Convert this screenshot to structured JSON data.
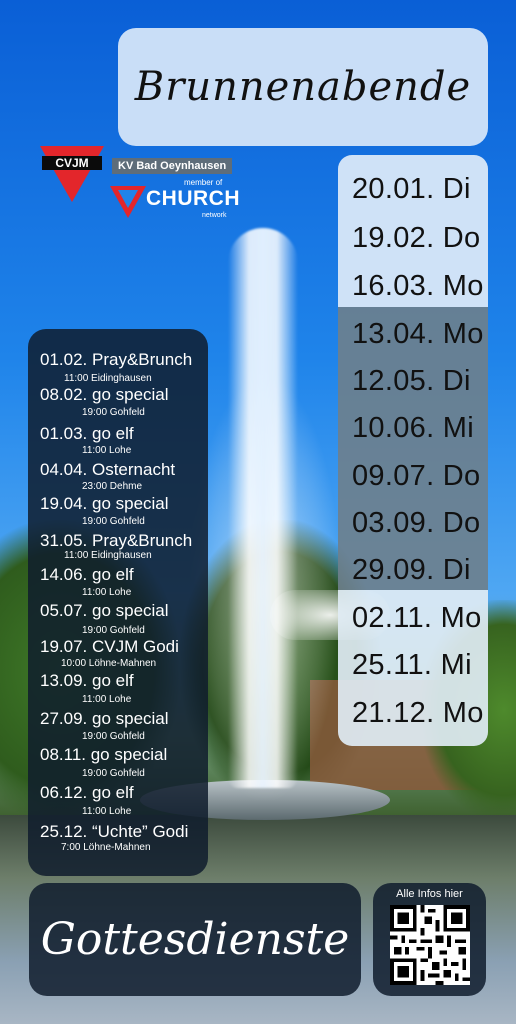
{
  "title": "Brunnenabende",
  "organization": {
    "logo_text": "CVJM",
    "branch": "KV Bad Oeynhausen",
    "member_of": "member of",
    "church": "CHURCH",
    "network": "network"
  },
  "brunnen_dates": [
    "20.01. Di",
    "19.02. Do",
    "16.03. Mo",
    "13.04. Mo",
    "12.05. Di",
    "10.06. Mi",
    "09.07. Do",
    "03.09. Do",
    "29.09. Di",
    "02.11. Mo",
    "25.11. Mi",
    "21.12. Mo"
  ],
  "events": [
    {
      "title": "01.02. Pray&Brunch",
      "sub": "11:00 Eidinghausen"
    },
    {
      "title": "08.02. go special",
      "sub": "19:00 Gohfeld"
    },
    {
      "title": "01.03. go elf",
      "sub": "11:00 Lohe"
    },
    {
      "title": "04.04. Osternacht",
      "sub": "23:00 Dehme"
    },
    {
      "title": "19.04. go special",
      "sub": "19:00 Gohfeld"
    },
    {
      "title": "31.05. Pray&Brunch",
      "sub": "11:00 Eidinghausen"
    },
    {
      "title": "14.06. go elf",
      "sub": "11:00 Lohe"
    },
    {
      "title": "05.07. go special",
      "sub": "19:00 Gohfeld"
    },
    {
      "title": "19.07. CVJM Godi",
      "sub": "10:00 Löhne-Mahnen"
    },
    {
      "title": "13.09. go elf",
      "sub": "11:00 Lohe"
    },
    {
      "title": "27.09. go special",
      "sub": "19:00 Gohfeld"
    },
    {
      "title": "08.11. go special",
      "sub": "19:00 Gohfeld"
    },
    {
      "title": "06.12. go elf",
      "sub": "11:00 Lohe"
    },
    {
      "title": "25.12. “Uchte” Godi",
      "sub": "7:00 Löhne-Mahnen"
    }
  ],
  "footer_title": "Gottesdienste",
  "qr_label": "Alle Infos hier",
  "colors": {
    "title_box": "#c9def7",
    "dark_panel": "#0f1c2d",
    "dates_middle": "#6e7f8c",
    "cvjm_red": "#e3262b"
  }
}
